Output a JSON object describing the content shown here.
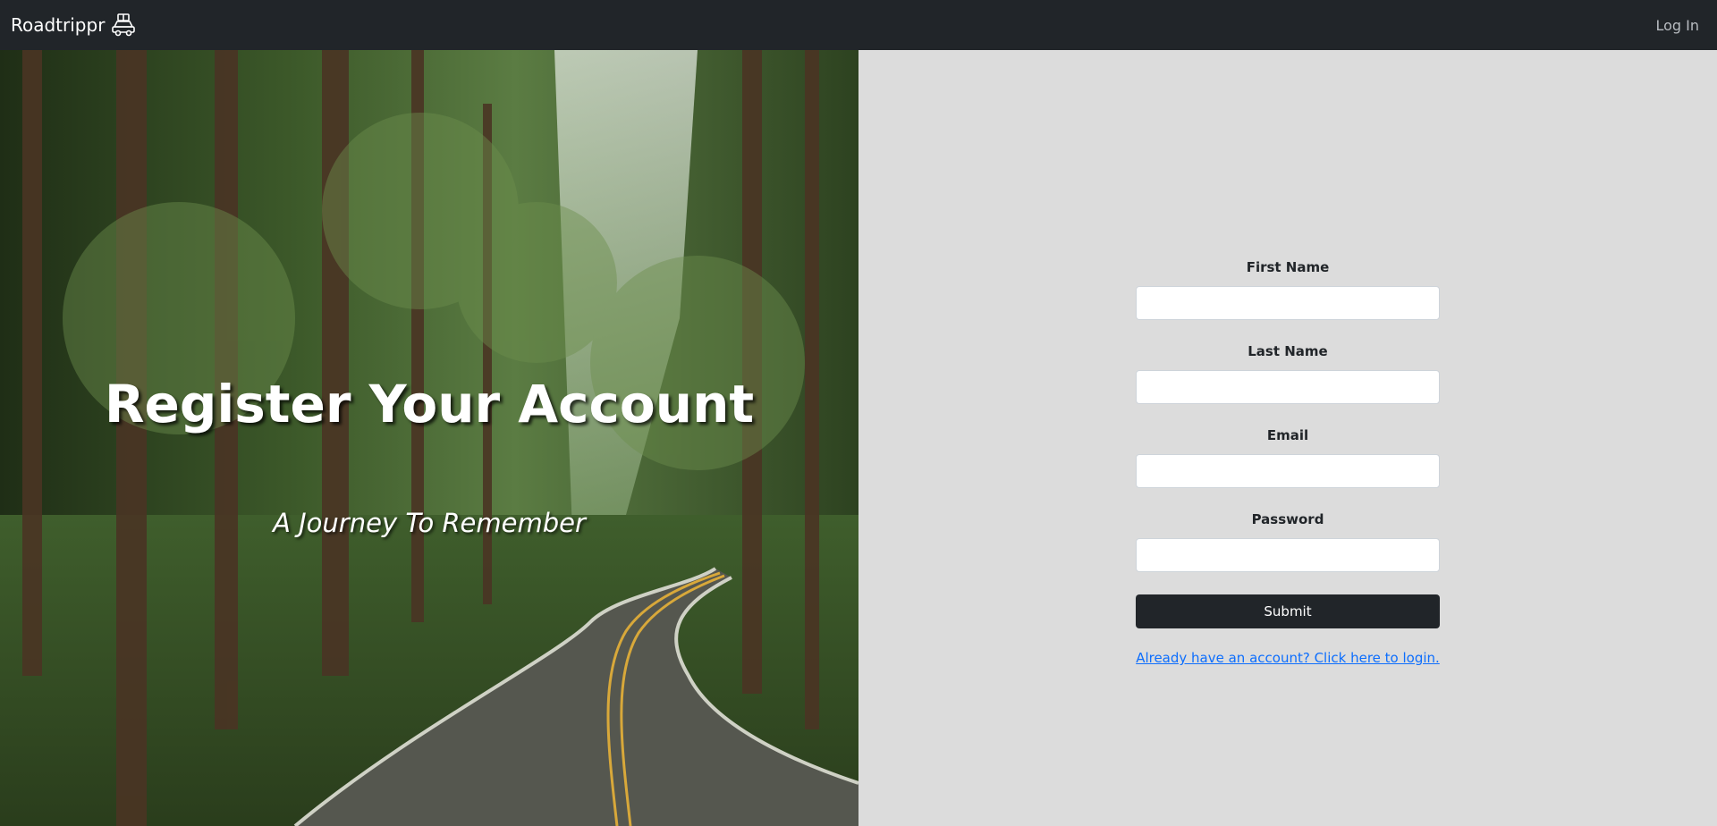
{
  "navbar": {
    "brand": "Roadtrippr",
    "brand_icon": "car-with-luggage-icon",
    "login_label": "Log In",
    "background": "#212529"
  },
  "hero": {
    "title": "Register Your Account",
    "subtitle": "A Journey To Remember"
  },
  "form": {
    "fields": [
      {
        "label": "First Name",
        "value": ""
      },
      {
        "label": "Last Name",
        "value": ""
      },
      {
        "label": "Email",
        "value": ""
      },
      {
        "label": "Password",
        "value": ""
      }
    ],
    "submit_label": "Submit",
    "login_link": "Already have an account? Click here to login."
  },
  "colors": {
    "panel_background": "#dcdcdc",
    "button": "#212529",
    "link": "#0d6efd"
  }
}
